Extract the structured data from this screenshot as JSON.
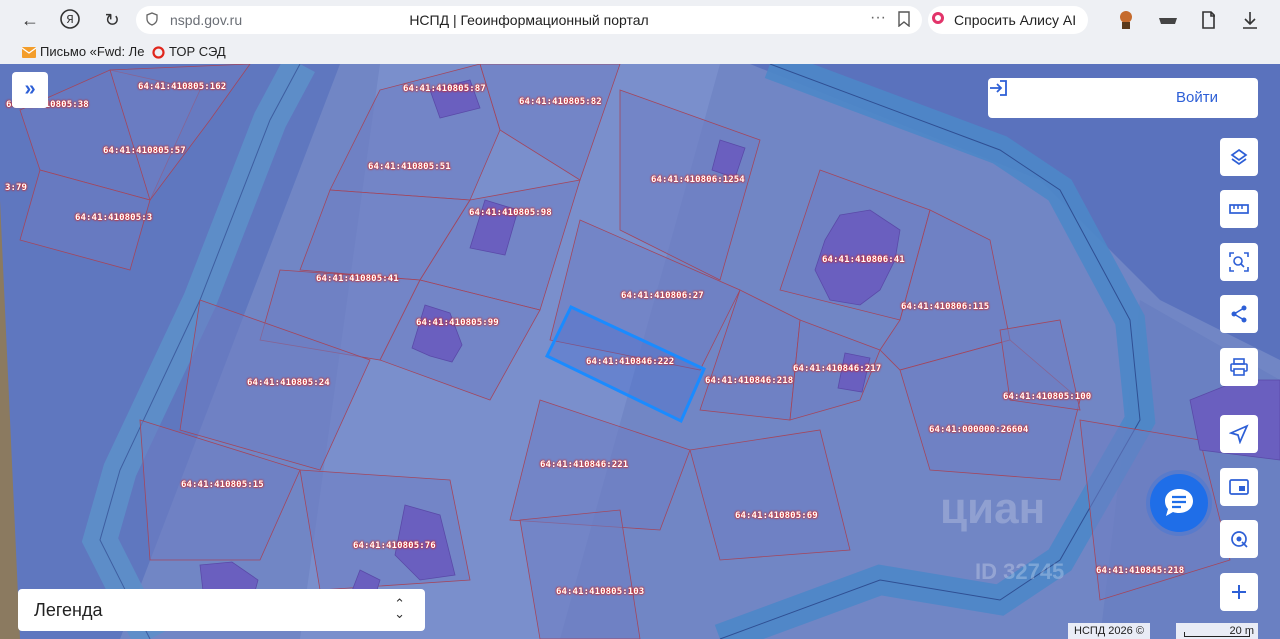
{
  "browser": {
    "url": "nspd.gov.ru",
    "tab_title": "НСПД | Геоинформационный портал",
    "more_label": "···",
    "alice_label": "Спросить Алису AI"
  },
  "bookmarks": [
    {
      "label": "Письмо «Fwd: Ле"
    },
    {
      "label": "ТОР СЭД"
    }
  ],
  "map": {
    "login_label": "Войти",
    "legend_label": "Легенда",
    "footer": "НСПД 2026 ©",
    "scale_label": "20 m",
    "watermark": "циан",
    "watermark_id": "ID 32745",
    "tools": [
      "layers-icon",
      "ruler-icon",
      "search-area-icon",
      "share-icon",
      "print-icon",
      "locate-icon",
      "minimap-icon",
      "geo-target-icon",
      "zoom-in-icon"
    ],
    "parcels": [
      {
        "label": "64:41:410805:38"
      },
      {
        "label": "64:41:410805:162"
      },
      {
        "label": "64:41:410805:87"
      },
      {
        "label": "64:41:410805:82"
      },
      {
        "label": "64:41:410805:57"
      },
      {
        "label": "64:41:410805:51"
      },
      {
        "label": "64:41:410806:1254"
      },
      {
        "label": "3:79"
      },
      {
        "label": "64:41:410805:3"
      },
      {
        "label": "64:41:410805:98"
      },
      {
        "label": "64:41:410806:41"
      },
      {
        "label": "64:41:410805:41"
      },
      {
        "label": "64:41:410806:27"
      },
      {
        "label": "64:41:410806:115"
      },
      {
        "label": "64:41:410805:99"
      },
      {
        "label": "64:41:410846:222"
      },
      {
        "label": "64:41:410846:217"
      },
      {
        "label": "64:41:410846:218"
      },
      {
        "label": "64:41:410805:24"
      },
      {
        "label": "64:41:410805:100"
      },
      {
        "label": "64:41:000000:26604"
      },
      {
        "label": "64:41:410846:221"
      },
      {
        "label": "64:41:410805:15"
      },
      {
        "label": "64:41:410805:69"
      },
      {
        "label": "64:41:410805:76"
      },
      {
        "label": "64:41:410845:218"
      },
      {
        "label": "64:41:410805:103"
      }
    ]
  }
}
